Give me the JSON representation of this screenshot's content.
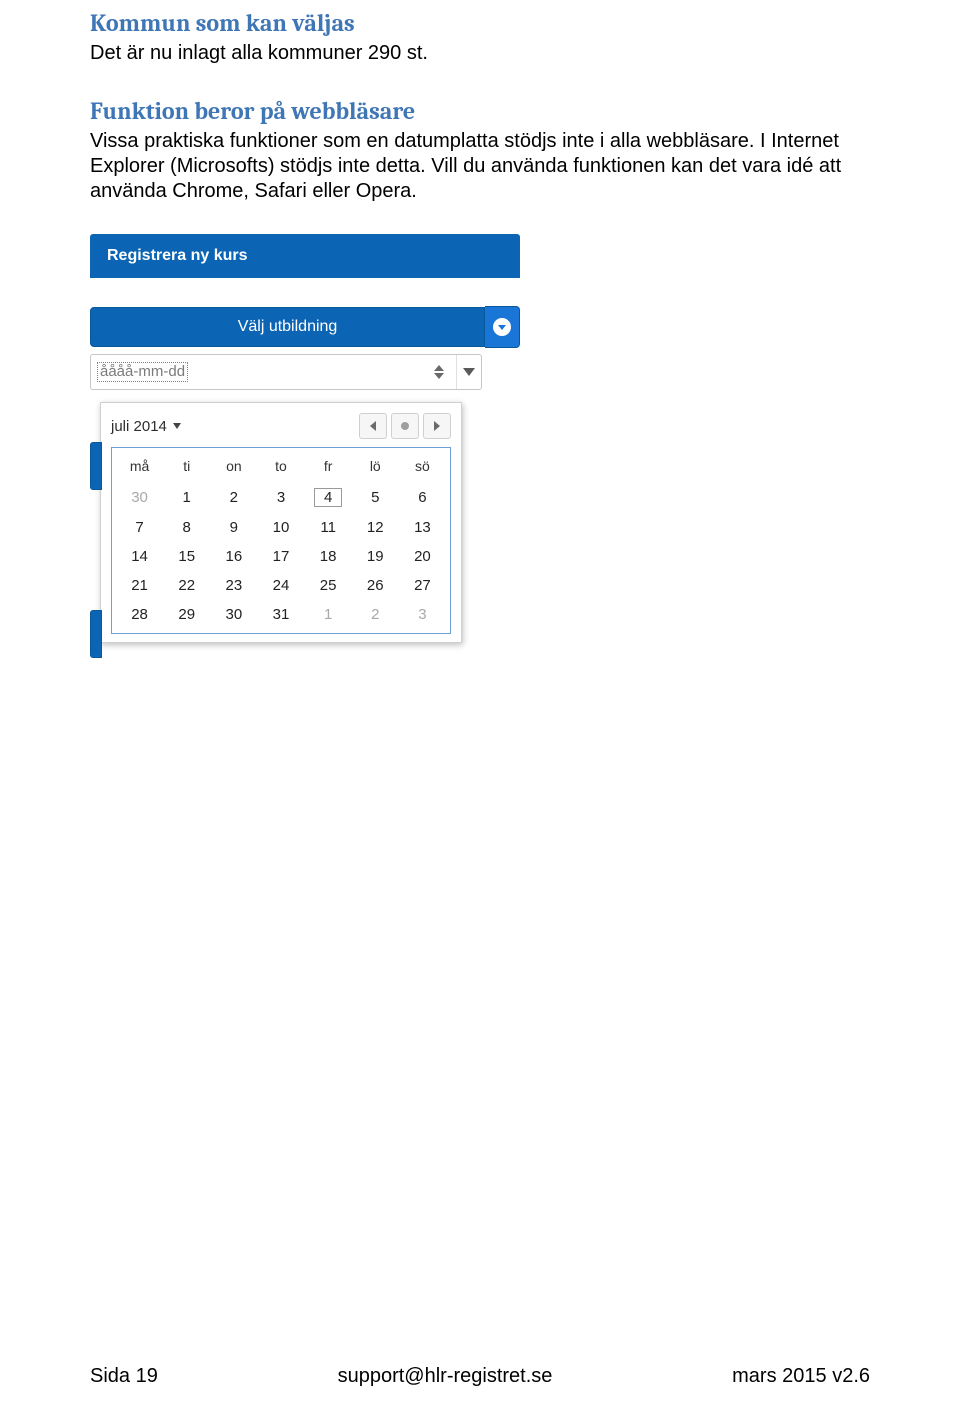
{
  "heading1": "Kommun som kan väljas",
  "body1": "Det är nu inlagt alla kommuner 290 st.",
  "heading2": "Funktion beror på webbläsare",
  "body2": "Vissa praktiska funktioner som en datumplatta stödjs inte i alla webbläsare. I Internet Explorer (Microsofts) stödjs inte detta. Vill du använda funktionen kan det vara idé att använda Chrome, Safari eller Opera.",
  "ui": {
    "register_label": "Registrera ny kurs",
    "select_label": "Välj utbildning",
    "date_placeholder": "åååå-mm-dd",
    "month_label": "juli 2014",
    "weekdays": [
      "må",
      "ti",
      "on",
      "to",
      "fr",
      "lö",
      "sö"
    ],
    "weeks": [
      [
        {
          "d": "30",
          "faded": true
        },
        {
          "d": "1"
        },
        {
          "d": "2"
        },
        {
          "d": "3"
        },
        {
          "d": "4",
          "boxed": true
        },
        {
          "d": "5"
        },
        {
          "d": "6"
        }
      ],
      [
        {
          "d": "7"
        },
        {
          "d": "8"
        },
        {
          "d": "9"
        },
        {
          "d": "10"
        },
        {
          "d": "11"
        },
        {
          "d": "12"
        },
        {
          "d": "13"
        }
      ],
      [
        {
          "d": "14"
        },
        {
          "d": "15"
        },
        {
          "d": "16"
        },
        {
          "d": "17"
        },
        {
          "d": "18"
        },
        {
          "d": "19"
        },
        {
          "d": "20"
        }
      ],
      [
        {
          "d": "21"
        },
        {
          "d": "22"
        },
        {
          "d": "23"
        },
        {
          "d": "24"
        },
        {
          "d": "25"
        },
        {
          "d": "26"
        },
        {
          "d": "27"
        }
      ],
      [
        {
          "d": "28"
        },
        {
          "d": "29"
        },
        {
          "d": "30"
        },
        {
          "d": "31"
        },
        {
          "d": "1",
          "faded": true
        },
        {
          "d": "2",
          "faded": true
        },
        {
          "d": "3",
          "faded": true
        }
      ]
    ]
  },
  "footer": {
    "left": "Sida 19",
    "center": "support@hlr-registret.se",
    "right": "mars 2015 v2.6"
  }
}
